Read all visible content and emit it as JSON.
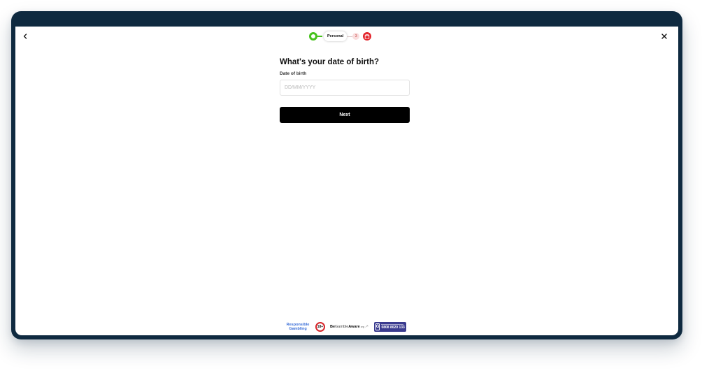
{
  "stepper": {
    "current_step_label": "Personal",
    "next_step_number": "3"
  },
  "form": {
    "title": "What's your date of birth?",
    "dob_label": "Date of birth",
    "dob_placeholder": "DD/MM/YYYY",
    "dob_value": "",
    "next_label": "Next"
  },
  "footer": {
    "responsible_gambling_line1": "Responsible",
    "responsible_gambling_line2": "Gambling",
    "age_badge": "18+",
    "begambleaware_be": "Be",
    "begambleaware_gamble": "Gamble",
    "begambleaware_aware": "Aware",
    "begambleaware_org": "org",
    "gamcare_phone": "0808 8020 133"
  },
  "colors": {
    "frame": "#0f2a40",
    "step_complete": "#46c21c",
    "gift_badge": "#e3242b",
    "primary_button": "#000000",
    "link_blue": "#3b6fd8",
    "gamcare": "#3a3b8f"
  },
  "icons": [
    "back-chevron-icon",
    "close-icon",
    "check-step-icon",
    "gift-icon",
    "arrow-icon"
  ]
}
